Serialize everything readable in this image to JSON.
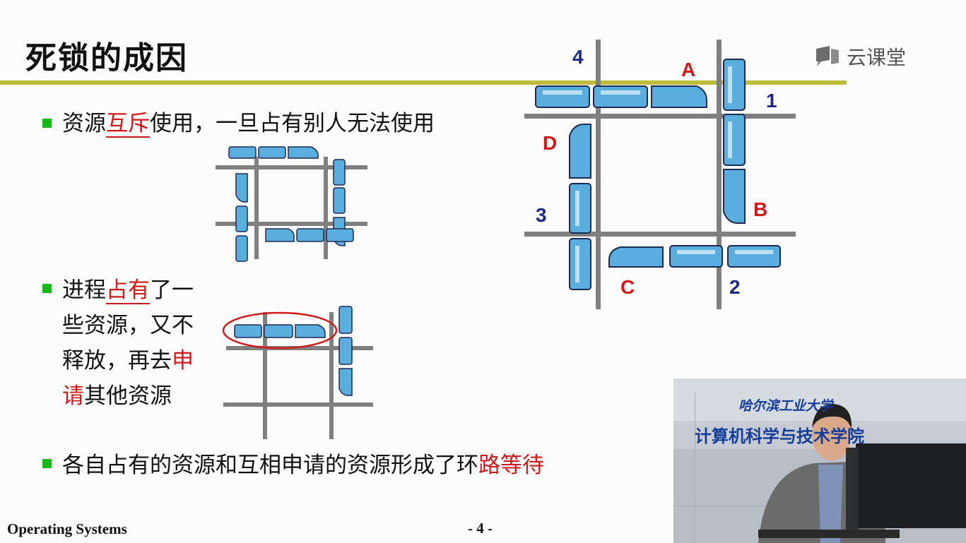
{
  "slide": {
    "title": "死锁的成因",
    "logo_text": "云课堂",
    "logo_icon": "chat-bubble-icon",
    "bullets": [
      {
        "pre": "资源",
        "red": "互斥",
        "post": "使用，一旦占有别人无法使用"
      },
      {
        "line1_pre": "进程",
        "line1_red": "占有",
        "line1_post": "了一",
        "line2": "些资源，又不",
        "line3_pre": "释放，再去",
        "line3_red": "申",
        "line4_red": "请",
        "line4_post": "其他资源"
      },
      {
        "pre": "各自占有的资源和互相申请的资源形成了环",
        "red": "路等待"
      }
    ],
    "diagram_labels": {
      "road_1": "1",
      "road_2": "2",
      "road_3": "3",
      "road_4": "4",
      "train_A": "A",
      "train_B": "B",
      "train_C": "C",
      "train_D": "D"
    },
    "footer_left": "Operating Systems",
    "page_number": "- 4 -"
  },
  "video": {
    "banner_top": "哈尔滨工业大学",
    "banner_bottom": "计算机科学与技术学院"
  },
  "colors": {
    "title_bar": "#bcbc38",
    "bullet": "#17b817",
    "highlight_red": "#d21818",
    "train_blue": "#5aaede",
    "road_gray": "#808080",
    "label_navy": "#1c2a86"
  }
}
